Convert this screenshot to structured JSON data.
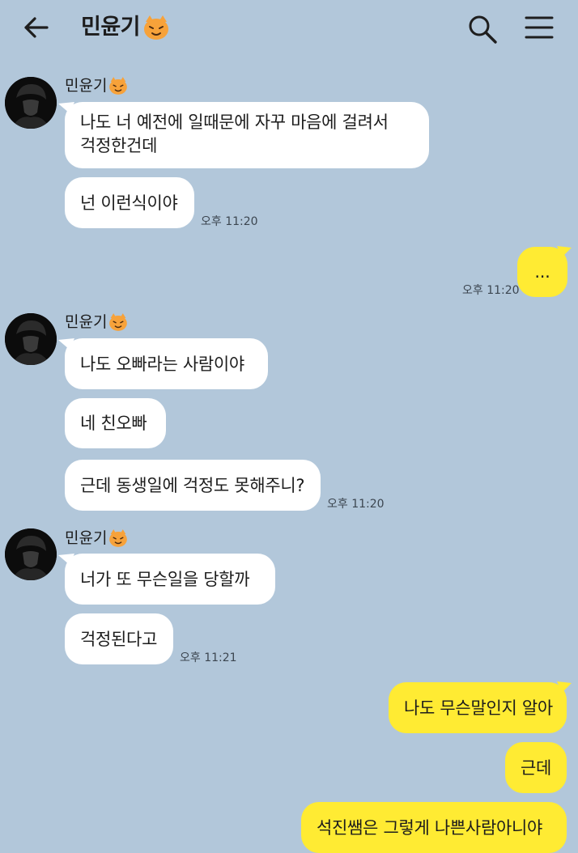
{
  "header": {
    "title": "민윤기",
    "back_icon": "arrow-left-icon",
    "search_icon": "search-icon",
    "menu_icon": "menu-icon"
  },
  "colors": {
    "background": "#b2c7da",
    "incoming_bubble": "#ffffff",
    "outgoing_bubble": "#ffeb33"
  },
  "messages": [
    {
      "sender": "민윤기",
      "bubbles": [
        "나도 너 예전에 일때문에 자꾸 마음에 걸려서\n걱정한건데",
        "넌 이런식이야"
      ],
      "time": "오후 11:20"
    },
    {
      "sender": "me",
      "bubbles": [
        "..."
      ],
      "time": "오후 11:20"
    },
    {
      "sender": "민윤기",
      "bubbles": [
        "나도 오빠라는 사람이야",
        "네 친오빠",
        "근데 동생일에 걱정도 못해주니?"
      ],
      "time": "오후 11:20"
    },
    {
      "sender": "민윤기",
      "bubbles": [
        "너가 또 무슨일을 당할까",
        "걱정된다고"
      ],
      "time": "오후 11:21"
    },
    {
      "sender": "me",
      "bubbles": [
        "나도 무슨말인지 알아",
        "근데",
        "석진쌤은 그렇게 나쁜사람아니야"
      ],
      "time": ""
    }
  ]
}
